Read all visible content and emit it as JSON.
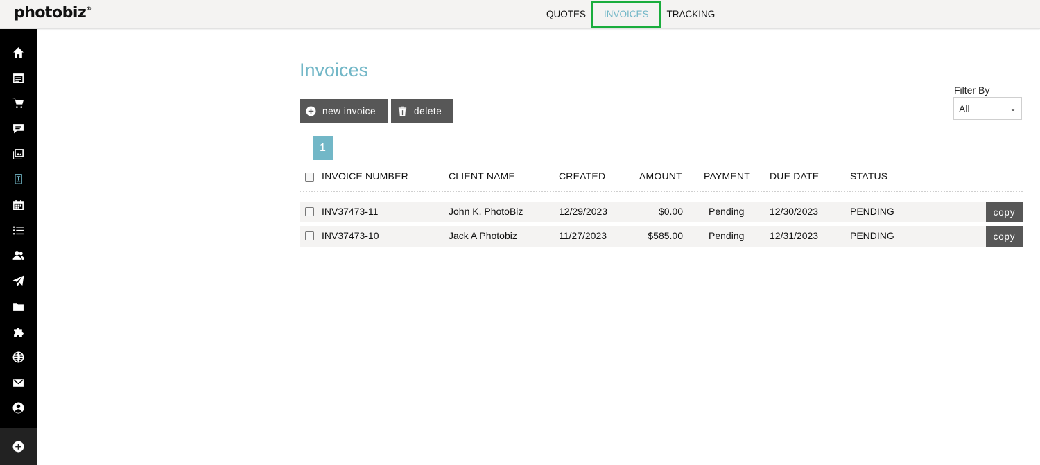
{
  "app": {
    "logo": "photobiz",
    "logo_mark": "®"
  },
  "top_nav": [
    "QUOTES",
    "INVOICES",
    "TRACKING"
  ],
  "sidebar_icons": [
    "home-icon",
    "calendar-list-icon",
    "cart-icon",
    "chat-icon",
    "gallery-icon",
    "invoice-icon",
    "calendar-icon",
    "list-icon",
    "users-icon",
    "send-icon",
    "folder-icon",
    "puzzle-icon",
    "globe-icon",
    "mail-icon",
    "account-icon"
  ],
  "sidebar_active": "invoice-icon",
  "sidebar_bottom_icon": "add-icon",
  "page": {
    "title": "Invoices"
  },
  "toolbar": {
    "new_label": "new invoice",
    "delete_label": "delete"
  },
  "filter": {
    "label": "Filter By",
    "value": "All",
    "chevron": "⌄"
  },
  "pagination": {
    "current": "1"
  },
  "table": {
    "headers": {
      "invoice_number": "INVOICE NUMBER",
      "client_name": "CLIENT NAME",
      "created": "CREATED",
      "amount": "AMOUNT",
      "payment": "PAYMENT",
      "due_date": "DUE DATE",
      "status": "STATUS"
    },
    "rows": [
      {
        "invoice_number": "INV37473-11",
        "client_name": "John K. PhotoBiz",
        "created": "12/29/2023",
        "amount": "$0.00",
        "payment": "Pending",
        "due_date": "12/30/2023",
        "status": "PENDING",
        "action": "copy"
      },
      {
        "invoice_number": "INV37473-10",
        "client_name": "Jack A Photobiz",
        "created": "11/27/2023",
        "amount": "$585.00",
        "payment": "Pending",
        "due_date": "12/31/2023",
        "status": "PENDING",
        "action": "copy"
      }
    ]
  },
  "colors": {
    "accent": "#72b7c7",
    "active_outline": "#1aad3d",
    "button": "#575757",
    "sidebar": "#000000"
  }
}
